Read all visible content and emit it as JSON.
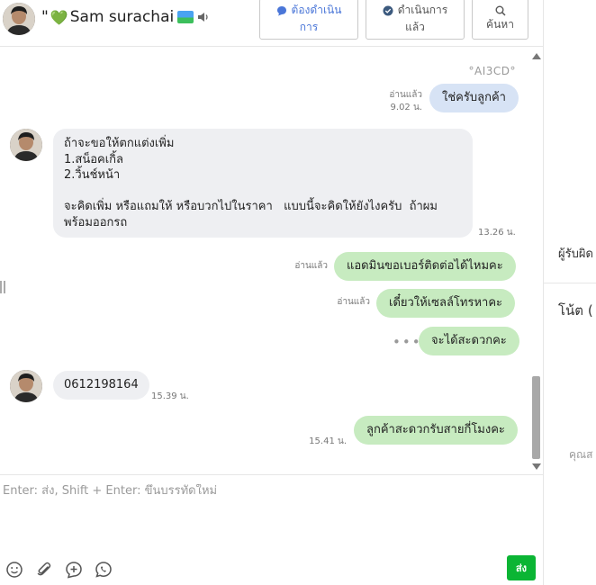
{
  "header": {
    "name_prefix": "\"",
    "name_heart": "💚",
    "name": "Sam surachai",
    "buttons": {
      "todo_line1": "ต้องดำเนิน",
      "todo_line2": "การ",
      "done_line1": "ดำเนินการ",
      "done_line2": "แล้ว",
      "search": "ค้นหา"
    }
  },
  "right_panel": {
    "responsible_label": "ผู้รับผิด",
    "note_label": "โน้ต",
    "note_count": "(",
    "hint": "คุณส"
  },
  "chat": {
    "header_tag": "°AI3CD°",
    "messages": [
      {
        "side": "out",
        "text": "ใช่ครับลูกค้า",
        "read": "อ่านแล้ว",
        "time": "9.02 น."
      },
      {
        "side": "in",
        "lines": [
          "ถ้าจะขอให้ตกแต่งเพิ่ม",
          "1.สน็อคเกิ้ล",
          "2.วิ้นช์หน้า",
          "",
          "จะคิดเพิ่ม หรือแถมให้ หรือบวกไปในราคา   แบบนี้จะคิดให้ยังไงครับ  ถ้าผม",
          "พร้อมออกรถ"
        ],
        "time": "13.26 น."
      },
      {
        "side": "out",
        "text": "แอดมินขอเบอร์ติดต่อได้ไหมคะ",
        "read": "อ่านแล้ว"
      },
      {
        "side": "out",
        "text": "เดี๋ยวให้เซลล์โทรหาคะ",
        "read": "อ่านแล้ว"
      },
      {
        "side": "out",
        "text": "จะได้สะดวกคะ",
        "more": "•••"
      },
      {
        "side": "in",
        "text": "0612198164",
        "time": "15.39 น."
      },
      {
        "side": "out",
        "text": "ลูกค้าสะดวกรับสายกี่โมงคะ",
        "time": "15.41 น."
      }
    ]
  },
  "composer": {
    "placeholder": "Enter: ส่ง, Shift + Enter: ขึ้นบรรทัดใหม่",
    "send": "ส่ง"
  },
  "colors": {
    "outgoing_green": "#c7ebc0",
    "outgoing_blue": "#d7e3f5",
    "incoming_gray": "#eeeff2",
    "send_button": "#0bb534",
    "accent_blue": "#4a76d8"
  },
  "icons": [
    "speaker-icon",
    "chat-bubble-icon",
    "check-circle-icon",
    "search-icon",
    "emoji-icon",
    "paperclip-icon",
    "add-icon",
    "whatsapp-icon"
  ]
}
